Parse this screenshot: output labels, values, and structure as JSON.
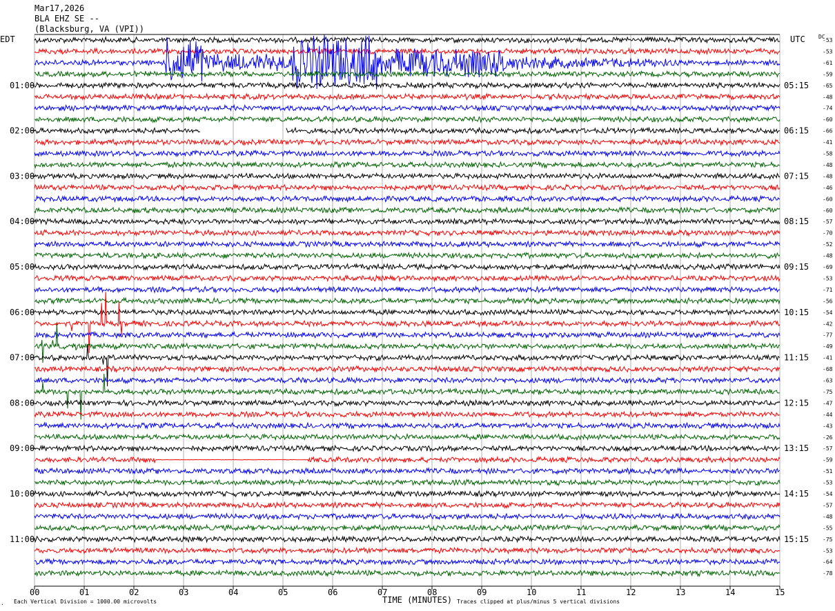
{
  "header": {
    "date": "Mar17,2026",
    "station": "BLA EHZ SE --",
    "location": "(Blacksburg, VA (VPI))"
  },
  "left_zone_label": "EDT",
  "right_zone_label": "UTC",
  "dc_header": "DC",
  "footer": {
    "division_note": "Each Vertical Division = 1000.00 microvolts",
    "xlabel": "TIME (MINUTES)",
    "clip_note": "Traces clipped at plus/minus 5 vertical divisions"
  },
  "colors": {
    "trace_cycle": [
      "#000000",
      "#ff0000",
      "#0000ff",
      "#006400"
    ],
    "grid": "#b0b0b0",
    "axis": "#000000"
  },
  "chart_data": {
    "type": "line",
    "subtype": "helicorder",
    "x_minutes": [
      0,
      15
    ],
    "xticks": [
      "00",
      "01",
      "02",
      "03",
      "04",
      "05",
      "06",
      "07",
      "08",
      "09",
      "10",
      "11",
      "12",
      "13",
      "14",
      "15"
    ],
    "grid": true,
    "row_count": 48,
    "minutes_per_row": 15,
    "left_time_labels": [
      {
        "row": 4,
        "label": "01:00"
      },
      {
        "row": 8,
        "label": "02:00"
      },
      {
        "row": 12,
        "label": "03:00"
      },
      {
        "row": 16,
        "label": "04:00"
      },
      {
        "row": 20,
        "label": "05:00"
      },
      {
        "row": 24,
        "label": "06:00"
      },
      {
        "row": 28,
        "label": "07:00"
      },
      {
        "row": 32,
        "label": "08:00"
      },
      {
        "row": 36,
        "label": "09:00"
      },
      {
        "row": 40,
        "label": "10:00"
      },
      {
        "row": 44,
        "label": "11:00"
      }
    ],
    "right_time_labels": [
      {
        "row": 4,
        "label": "05:15"
      },
      {
        "row": 8,
        "label": "06:15"
      },
      {
        "row": 12,
        "label": "07:15"
      },
      {
        "row": 16,
        "label": "08:15"
      },
      {
        "row": 20,
        "label": "09:15"
      },
      {
        "row": 24,
        "label": "10:15"
      },
      {
        "row": 28,
        "label": "11:15"
      },
      {
        "row": 32,
        "label": "12:15"
      },
      {
        "row": 36,
        "label": "13:15"
      },
      {
        "row": 40,
        "label": "14:15"
      },
      {
        "row": 44,
        "label": "15:15"
      }
    ],
    "dc_offsets": [
      -53,
      -53,
      -61,
      -59,
      -65,
      -48,
      -74,
      -60,
      -66,
      -41,
      -58,
      -48,
      -48,
      -46,
      -60,
      -60,
      -57,
      -70,
      -52,
      -48,
      -69,
      -53,
      -71,
      -56,
      -54,
      -42,
      -77,
      -49,
      -41,
      -68,
      -63,
      -75,
      -47,
      -44,
      -43,
      -26,
      -57,
      -59,
      -51,
      -53,
      -54,
      -57,
      -48,
      -55,
      -75,
      -53,
      -64,
      -78
    ],
    "events": [
      {
        "row": 2,
        "start_min": 2.65,
        "end_min": 12.9,
        "description": "large-amplitude burst"
      },
      {
        "row": 25,
        "start_min": 0.0,
        "end_min": 1.9,
        "description": "spikes"
      },
      {
        "row": 27,
        "start_min": 0.0,
        "end_min": 1.9,
        "description": "spikes"
      },
      {
        "row": 28,
        "start_min": 0.0,
        "end_min": 1.9,
        "description": "spikes"
      },
      {
        "row": 31,
        "start_min": 0.0,
        "end_min": 1.6,
        "description": "spikes"
      }
    ],
    "gaps": [
      {
        "row": 8,
        "start_min": 3.35,
        "end_min": 5.05
      },
      {
        "row": 37,
        "start_min": 2.45,
        "end_min": 5.5,
        "flat": true
      }
    ]
  }
}
